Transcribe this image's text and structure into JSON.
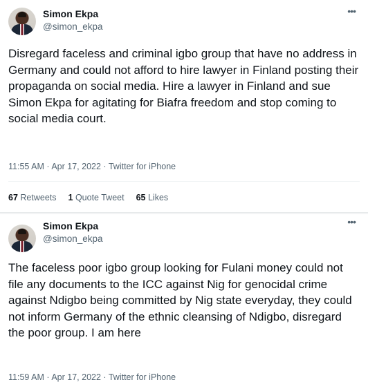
{
  "tweets": [
    {
      "author": {
        "name": "Simon Ekpa",
        "handle": "@simon_ekpa"
      },
      "text": "Disregard faceless and criminal igbo group that have no address in Germany and could not afford to hire lawyer in Finland posting their propaganda on social media. Hire a lawyer in Finland and sue Simon Ekpa for agitating for Biafra freedom and stop coming to social media court.",
      "time": "11:55 AM",
      "date": "Apr 17, 2022",
      "source": "Twitter for iPhone",
      "stats": {
        "retweets_count": "67",
        "retweets_label": "Retweets",
        "quotes_count": "1",
        "quotes_label": "Quote Tweet",
        "likes_count": "65",
        "likes_label": "Likes"
      }
    },
    {
      "author": {
        "name": "Simon Ekpa",
        "handle": "@simon_ekpa"
      },
      "text": "The faceless poor igbo group looking for Fulani money could not file any documents to the ICC against Nig for genocidal crime against Ndigbo being committed by Nig state everyday, they could not inform Germany of the ethnic cleansing of Ndigbo, disregard the poor group. I am here",
      "time": "11:59 AM",
      "date": "Apr 17, 2022",
      "source": "Twitter for iPhone"
    }
  ],
  "separator": "·",
  "icons": {
    "more": "more-horizontal-icon",
    "more_glyph": "•••"
  }
}
